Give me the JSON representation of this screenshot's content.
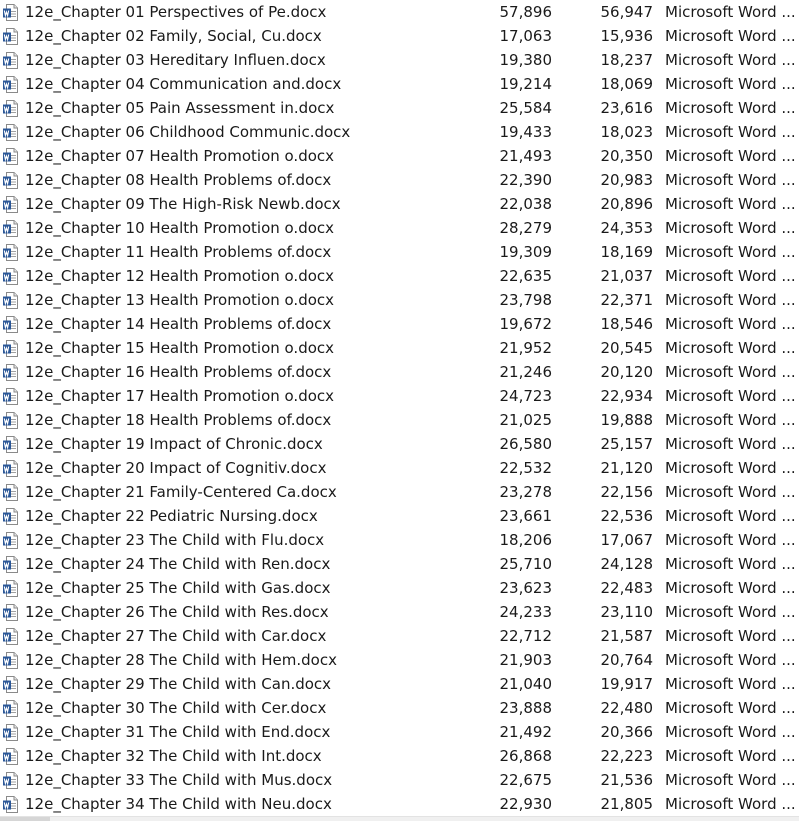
{
  "files": [
    {
      "name": "12e_Chapter 01 Perspectives of Pe.docx",
      "size": "57,896",
      "packed": "56,947",
      "type": "Microsoft Word ..."
    },
    {
      "name": "12e_Chapter 02 Family, Social, Cu.docx",
      "size": "17,063",
      "packed": "15,936",
      "type": "Microsoft Word ..."
    },
    {
      "name": "12e_Chapter 03 Hereditary Influen.docx",
      "size": "19,380",
      "packed": "18,237",
      "type": "Microsoft Word ..."
    },
    {
      "name": "12e_Chapter 04 Communication and.docx",
      "size": "19,214",
      "packed": "18,069",
      "type": "Microsoft Word ..."
    },
    {
      "name": "12e_Chapter 05 Pain Assessment in.docx",
      "size": "25,584",
      "packed": "23,616",
      "type": "Microsoft Word ..."
    },
    {
      "name": "12e_Chapter 06 Childhood Communic.docx",
      "size": "19,433",
      "packed": "18,023",
      "type": "Microsoft Word ..."
    },
    {
      "name": "12e_Chapter 07 Health Promotion o.docx",
      "size": "21,493",
      "packed": "20,350",
      "type": "Microsoft Word ..."
    },
    {
      "name": "12e_Chapter 08 Health Problems of.docx",
      "size": "22,390",
      "packed": "20,983",
      "type": "Microsoft Word ..."
    },
    {
      "name": "12e_Chapter 09 The High-Risk Newb.docx",
      "size": "22,038",
      "packed": "20,896",
      "type": "Microsoft Word ..."
    },
    {
      "name": "12e_Chapter 10 Health Promotion o.docx",
      "size": "28,279",
      "packed": "24,353",
      "type": "Microsoft Word ..."
    },
    {
      "name": "12e_Chapter 11 Health Problems of.docx",
      "size": "19,309",
      "packed": "18,169",
      "type": "Microsoft Word ..."
    },
    {
      "name": "12e_Chapter 12 Health Promotion o.docx",
      "size": "22,635",
      "packed": "21,037",
      "type": "Microsoft Word ..."
    },
    {
      "name": "12e_Chapter 13 Health Promotion o.docx",
      "size": "23,798",
      "packed": "22,371",
      "type": "Microsoft Word ..."
    },
    {
      "name": "12e_Chapter 14 Health Problems of.docx",
      "size": "19,672",
      "packed": "18,546",
      "type": "Microsoft Word ..."
    },
    {
      "name": "12e_Chapter 15 Health Promotion o.docx",
      "size": "21,952",
      "packed": "20,545",
      "type": "Microsoft Word ..."
    },
    {
      "name": "12e_Chapter 16 Health Problems of.docx",
      "size": "21,246",
      "packed": "20,120",
      "type": "Microsoft Word ..."
    },
    {
      "name": "12e_Chapter 17 Health Promotion o.docx",
      "size": "24,723",
      "packed": "22,934",
      "type": "Microsoft Word ..."
    },
    {
      "name": "12e_Chapter 18 Health Problems of.docx",
      "size": "21,025",
      "packed": "19,888",
      "type": "Microsoft Word ..."
    },
    {
      "name": "12e_Chapter 19 Impact of Chronic.docx",
      "size": "26,580",
      "packed": "25,157",
      "type": "Microsoft Word ..."
    },
    {
      "name": "12e_Chapter 20 Impact of Cognitiv.docx",
      "size": "22,532",
      "packed": "21,120",
      "type": "Microsoft Word ..."
    },
    {
      "name": "12e_Chapter 21 Family-Centered Ca.docx",
      "size": "23,278",
      "packed": "22,156",
      "type": "Microsoft Word ..."
    },
    {
      "name": "12e_Chapter 22 Pediatric Nursing.docx",
      "size": "23,661",
      "packed": "22,536",
      "type": "Microsoft Word ..."
    },
    {
      "name": "12e_Chapter 23 The Child with Flu.docx",
      "size": "18,206",
      "packed": "17,067",
      "type": "Microsoft Word ..."
    },
    {
      "name": "12e_Chapter 24 The Child with Ren.docx",
      "size": "25,710",
      "packed": "24,128",
      "type": "Microsoft Word ..."
    },
    {
      "name": "12e_Chapter 25 The Child with Gas.docx",
      "size": "23,623",
      "packed": "22,483",
      "type": "Microsoft Word ..."
    },
    {
      "name": "12e_Chapter 26 The Child with Res.docx",
      "size": "24,233",
      "packed": "23,110",
      "type": "Microsoft Word ..."
    },
    {
      "name": "12e_Chapter 27 The Child with Car.docx",
      "size": "22,712",
      "packed": "21,587",
      "type": "Microsoft Word ..."
    },
    {
      "name": "12e_Chapter 28 The Child with Hem.docx",
      "size": "21,903",
      "packed": "20,764",
      "type": "Microsoft Word ..."
    },
    {
      "name": "12e_Chapter 29 The Child with Can.docx",
      "size": "21,040",
      "packed": "19,917",
      "type": "Microsoft Word ..."
    },
    {
      "name": "12e_Chapter 30 The Child with Cer.docx",
      "size": "23,888",
      "packed": "22,480",
      "type": "Microsoft Word ..."
    },
    {
      "name": "12e_Chapter 31 The Child with End.docx",
      "size": "21,492",
      "packed": "20,366",
      "type": "Microsoft Word ..."
    },
    {
      "name": "12e_Chapter 32 The Child with Int.docx",
      "size": "26,868",
      "packed": "22,223",
      "type": "Microsoft Word ..."
    },
    {
      "name": "12e_Chapter 33 The Child with Mus.docx",
      "size": "22,675",
      "packed": "21,536",
      "type": "Microsoft Word ..."
    },
    {
      "name": "12e_Chapter 34 The Child with Neu.docx",
      "size": "22,930",
      "packed": "21,805",
      "type": "Microsoft Word ..."
    }
  ],
  "icons": {
    "file": "word-document-icon",
    "accent": "#2b5797"
  }
}
